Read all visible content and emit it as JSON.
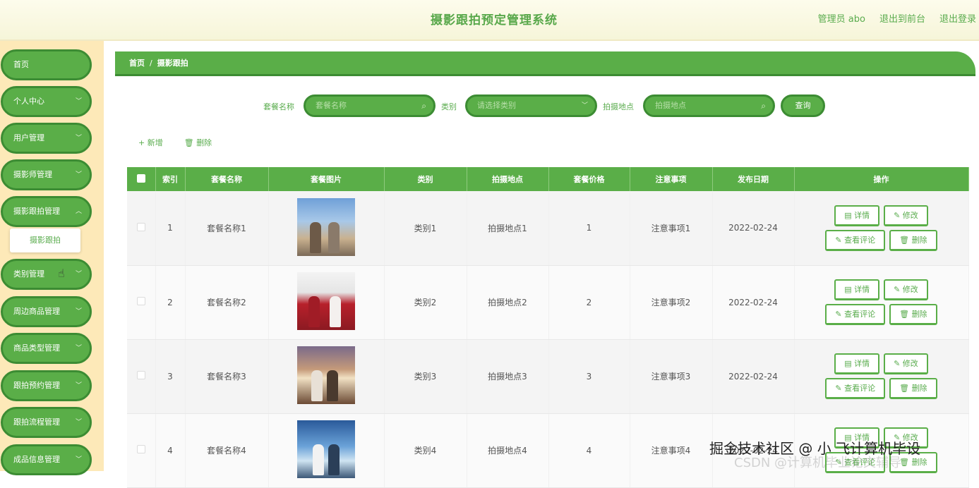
{
  "header": {
    "title": "摄影跟拍预定管理系统",
    "admin_label": "管理员 abo",
    "to_front": "退出到前台",
    "logout": "退出登录"
  },
  "sidebar": {
    "items": [
      {
        "label": "首页",
        "has_chevron": false
      },
      {
        "label": "个人中心",
        "has_chevron": true
      },
      {
        "label": "用户管理",
        "has_chevron": true
      },
      {
        "label": "摄影师管理",
        "has_chevron": true
      },
      {
        "label": "摄影跟拍管理",
        "has_chevron": true
      },
      {
        "label": "类别管理",
        "has_chevron": true
      },
      {
        "label": "周边商品管理",
        "has_chevron": true
      },
      {
        "label": "商品类型管理",
        "has_chevron": true
      },
      {
        "label": "跟拍预约管理",
        "has_chevron": true
      },
      {
        "label": "跟拍流程管理",
        "has_chevron": true
      },
      {
        "label": "成品信息管理",
        "has_chevron": true
      }
    ],
    "sub_item": "摄影跟拍"
  },
  "breadcrumb": {
    "home": "首页",
    "sep": "/",
    "current": "摄影跟拍"
  },
  "search": {
    "package_label": "套餐名称",
    "package_placeholder": "套餐名称",
    "category_label": "类别",
    "category_placeholder": "请选择类别",
    "location_label": "拍摄地点",
    "location_placeholder": "拍摄地点",
    "query_button": "查询"
  },
  "actions": {
    "add": "+ 新增",
    "delete": "删除"
  },
  "table": {
    "headers": [
      "索引",
      "套餐名称",
      "套餐图片",
      "类别",
      "拍摄地点",
      "套餐价格",
      "注意事项",
      "发布日期",
      "操作"
    ],
    "rows": [
      {
        "index": "1",
        "name": "套餐名称1",
        "category": "类别1",
        "location": "拍摄地点1",
        "price": "1",
        "notes": "注意事项1",
        "date": "2022-02-24"
      },
      {
        "index": "2",
        "name": "套餐名称2",
        "category": "类别2",
        "location": "拍摄地点2",
        "price": "2",
        "notes": "注意事项2",
        "date": "2022-02-24"
      },
      {
        "index": "3",
        "name": "套餐名称3",
        "category": "类别3",
        "location": "拍摄地点3",
        "price": "3",
        "notes": "注意事项3",
        "date": "2022-02-24"
      },
      {
        "index": "4",
        "name": "套餐名称4",
        "category": "类别4",
        "location": "拍摄地点4",
        "price": "4",
        "notes": "注意事项4",
        "date": "2022-02-24"
      }
    ],
    "ops": {
      "detail": "详情",
      "edit": "修改",
      "reviews": "查看评论",
      "delete": "删除"
    }
  },
  "watermark": {
    "main": "掘金技术社区 @ 小 飞计算机毕设",
    "sub": "CSDN @计算机毕业论文辅导"
  },
  "colors": {
    "primary": "#5aae48",
    "primary_dark": "#3c8c33",
    "sidebar_bg": "#fde9b8",
    "header_bg": "#fdfcec"
  }
}
